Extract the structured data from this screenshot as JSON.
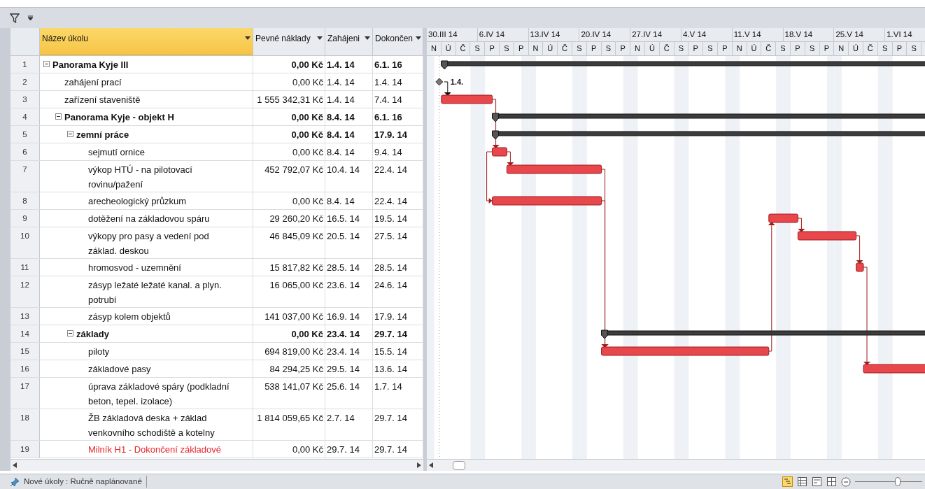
{
  "table": {
    "columns": [
      {
        "label": "Název úkolu",
        "selected": true
      },
      {
        "label": "Pevné náklady",
        "selected": false
      },
      {
        "label": "Zahájeni",
        "selected": false
      },
      {
        "label": "Dokončen",
        "selected": false
      }
    ],
    "rows": [
      {
        "number": "1",
        "name": "Panorama Kyje III",
        "cost": "0,00 Kč",
        "start": "1.4. 14",
        "end": "6.1. 16",
        "kind": "summary",
        "expanded": true,
        "highlighted": false,
        "children": [
          {
            "number": "2",
            "name": "zahájení prací",
            "cost": "0,00 Kč",
            "start": "1.4. 14",
            "end": "1.4. 14",
            "kind": "milestone",
            "highlighted": false,
            "gantt_label": "1.4."
          },
          {
            "number": "3",
            "name": "zařízení staveniště",
            "cost": "1 555 342,31 Kč",
            "start": "1.4. 14",
            "end": "7.4. 14",
            "kind": "task",
            "highlighted": false
          },
          {
            "number": "4",
            "name": "Panorama Kyje  - objekt H",
            "cost": "0,00 Kč",
            "start": "8.4. 14",
            "end": "6.1. 16",
            "kind": "summary",
            "expanded": true,
            "highlighted": false,
            "children": [
              {
                "number": "5",
                "name": "zemní práce",
                "cost": "0,00 Kč",
                "start": "8.4. 14",
                "end": "17.9. 14",
                "kind": "summary",
                "expanded": true,
                "highlighted": false,
                "children": [
                  {
                    "number": "6",
                    "name": "sejmutí ornice",
                    "cost": "0,00 Kč",
                    "start": "8.4. 14",
                    "end": "9.4. 14",
                    "kind": "task",
                    "highlighted": false
                  },
                  {
                    "number": "7",
                    "name": "výkop HTÚ - na pilotovací rovinu/pažení",
                    "cost": "452 792,07 Kč",
                    "start": "10.4. 14",
                    "end": "22.4. 14",
                    "kind": "task",
                    "highlighted": false
                  },
                  {
                    "number": "8",
                    "name": "arecheologický průzkum",
                    "cost": "0,00 Kč",
                    "start": "8.4. 14",
                    "end": "22.4. 14",
                    "kind": "task",
                    "highlighted": false
                  },
                  {
                    "number": "9",
                    "name": "dotěžení na základovou spáru",
                    "cost": "29 260,20 Kč",
                    "start": "16.5. 14",
                    "end": "19.5. 14",
                    "kind": "task",
                    "highlighted": false
                  },
                  {
                    "number": "10",
                    "name": "výkopy pro pasy a vedení pod základ. deskou",
                    "cost": "46 845,09 Kč",
                    "start": "20.5. 14",
                    "end": "27.5. 14",
                    "kind": "task",
                    "highlighted": false
                  },
                  {
                    "number": "11",
                    "name": "hromosvod - uzemnění",
                    "cost": "15 817,82 Kč",
                    "start": "28.5. 14",
                    "end": "28.5. 14",
                    "kind": "task",
                    "highlighted": false
                  },
                  {
                    "number": "12",
                    "name": "zásyp ležaté ležaté kanal. a plyn. potrubí",
                    "cost": "16 065,00 Kč",
                    "start": "23.6. 14",
                    "end": "24.6. 14",
                    "kind": "task",
                    "highlighted": false
                  },
                  {
                    "number": "13",
                    "name": "zásyp kolem objektů",
                    "cost": "141 037,00 Kč",
                    "start": "16.9. 14",
                    "end": "17.9. 14",
                    "kind": "task",
                    "highlighted": false
                  }
                ]
              },
              {
                "number": "14",
                "name": "základy",
                "cost": "0,00 Kč",
                "start": "23.4. 14",
                "end": "29.7. 14",
                "kind": "summary",
                "expanded": true,
                "highlighted": false,
                "children": [
                  {
                    "number": "15",
                    "name": "piloty",
                    "cost": "694 819,00 Kč",
                    "start": "23.4. 14",
                    "end": "15.5. 14",
                    "kind": "task",
                    "highlighted": false
                  },
                  {
                    "number": "16",
                    "name": "základové pasy",
                    "cost": "84 294,25 Kč",
                    "start": "29.5. 14",
                    "end": "13.6. 14",
                    "kind": "task",
                    "highlighted": false
                  },
                  {
                    "number": "17",
                    "name": "úprava základové spáry (podkladní beton, tepel. izolace)",
                    "cost": "538 141,07 Kč",
                    "start": "25.6. 14",
                    "end": "1.7. 14",
                    "kind": "task",
                    "highlighted": false
                  },
                  {
                    "number": "18",
                    "name": "ŽB základová deska + základ venkovního schodiště a kotelny",
                    "cost": "1 814 059,65 Kč",
                    "start": "2.7. 14",
                    "end": "29.7. 14",
                    "kind": "task",
                    "highlighted": false
                  },
                  {
                    "number": "19",
                    "name": "Milník H1 - Dokončení základové",
                    "cost": "0,00 Kč",
                    "start": "29.7. 14",
                    "end": "29.7. 14",
                    "kind": "milestone",
                    "highlighted": true
                  }
                ]
              }
            ]
          }
        ]
      }
    ]
  },
  "gantt": {
    "weeks": [
      "30.III 14",
      "6.IV 14",
      "13.IV 14",
      "20.IV 14",
      "27.IV 14",
      "4.V 14",
      "11.V 14",
      "18.V 14",
      "25.V 14",
      "1.VI 14"
    ],
    "days": [
      "N",
      "Ú",
      "Č",
      "S",
      "P",
      "S",
      "P",
      "N",
      "Ú",
      "Č",
      "S",
      "P",
      "S",
      "P",
      "N",
      "Ú",
      "Č",
      "S",
      "P",
      "S",
      "P",
      "N",
      "Ú",
      "Č",
      "S",
      "P",
      "S",
      "P",
      "N",
      "Ú",
      "Č",
      "S",
      "P",
      "S"
    ]
  },
  "status_bar": {
    "text": "Nové úkoly : Ručně naplánované",
    "zoom": {
      "level": 0.64
    }
  }
}
